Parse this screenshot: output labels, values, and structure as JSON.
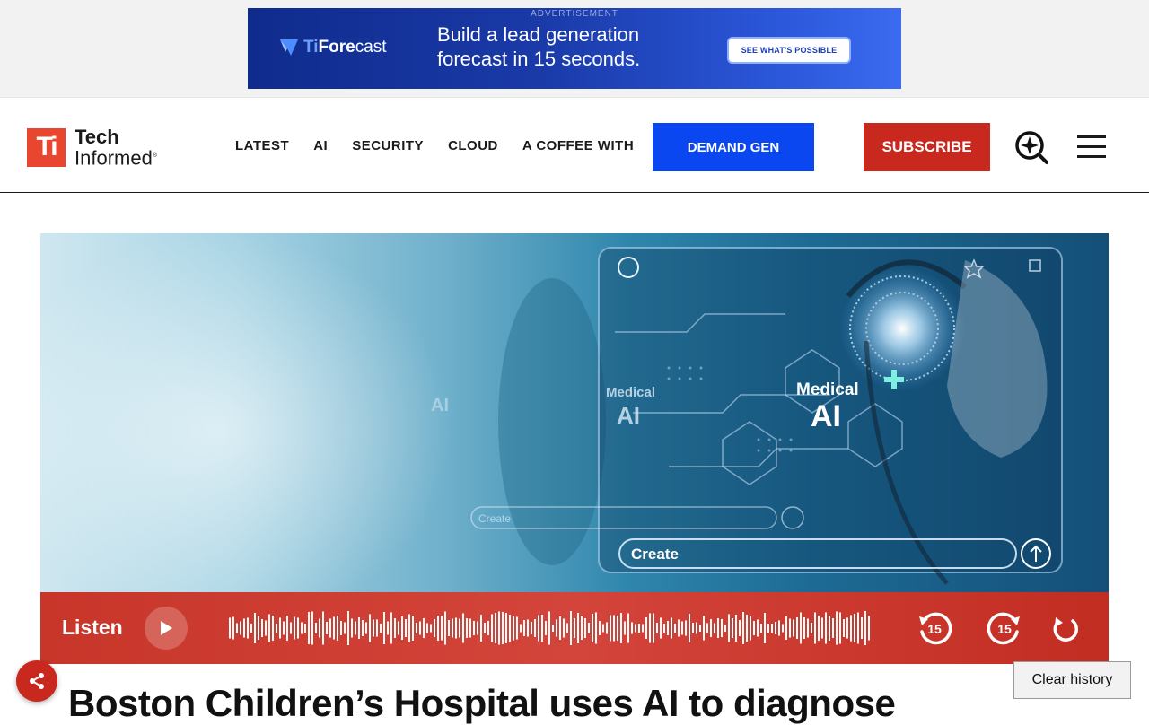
{
  "ad": {
    "label": "ADVERTISEMENT",
    "brand_prefix": "Ti",
    "brand_bold": "Fore",
    "brand_rest": "cast",
    "headline_line1": "Build a lead generation",
    "headline_line2": "forecast in 15 seconds.",
    "cta": "SEE WHAT'S POSSIBLE"
  },
  "header": {
    "logo_mark": "Ti",
    "logo_line1": "Tech",
    "logo_line2": "Informed",
    "logo_reg": "®",
    "nav": [
      "LATEST",
      "AI",
      "SECURITY",
      "CLOUD",
      "A COFFEE WITH"
    ],
    "demand_gen": "DEMAND GEN",
    "subscribe": "SUBSCRIBE",
    "icons": {
      "search": "search-sparkle-icon",
      "menu": "hamburger-menu-icon"
    }
  },
  "hero": {
    "overlay_label_1": "Medical",
    "overlay_label_1b": "AI",
    "overlay_label_2": "Medical",
    "overlay_label_2b": "AI",
    "overlay_label_3": "AI",
    "input_1": "Create",
    "input_2": "Create"
  },
  "player": {
    "listen": "Listen",
    "icons": {
      "play": "play-icon",
      "rewind": "rewind-15-icon",
      "forward": "forward-15-icon",
      "replay": "replay-icon"
    },
    "rewind_label": "15",
    "forward_label": "15"
  },
  "article": {
    "headline": "Boston Children’s Hospital uses AI to diagnose"
  },
  "floating": {
    "share_icon": "share-icon",
    "clear_history": "Clear history"
  },
  "colors": {
    "brand_red": "#c8281e",
    "demand_blue": "#0a47f0",
    "ad_blue": "#1a3aa8"
  }
}
